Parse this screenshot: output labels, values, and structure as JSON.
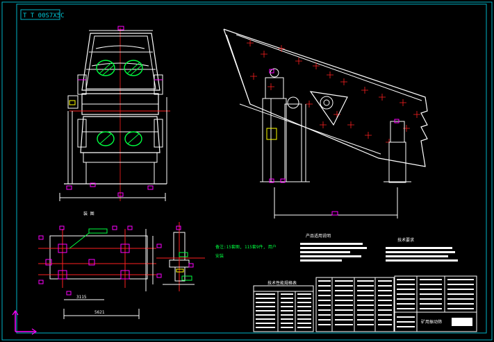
{
  "drawing": {
    "title_code": "T T 00S7X5C",
    "label_side_view": "装 图",
    "label_product_notes": "产品适用说明",
    "label_tech_req": "技术要求",
    "label_perf_table": "技术性能规格表",
    "note_line1": "备注:15套图, 115套9件, 用户",
    "note_line2": "安装",
    "title_block_name": "矿用振动筛",
    "dim_bottom": "5621",
    "dim_plan_w": "3115",
    "colors": {
      "background": "#000000",
      "frame": "#00b4c8",
      "geometry": "#ffffff",
      "centerline": "#ff2020",
      "dimension": "#ff00ff",
      "annotation": "#00ff40"
    }
  }
}
